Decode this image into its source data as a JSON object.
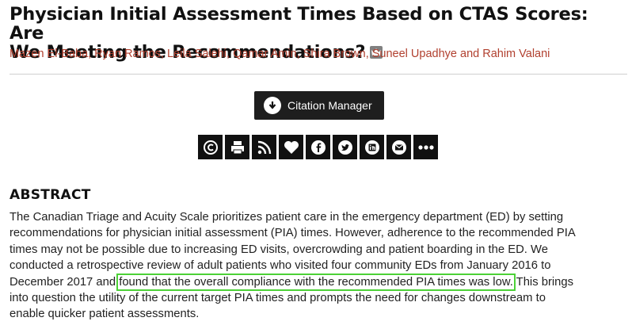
{
  "article": {
    "title_line1": "Physician Initial Assessment Times Based on CTAS Scores: Are",
    "title_line2": "We Meeting the Recommendations?",
    "authors": "Mazen El-Baba, Ryan Ramos, Leila Salehi, Qamar Amin, Shira Brown, Suneel Upadhye and Rahim Valani"
  },
  "actions": {
    "citation_manager": "Citation Manager",
    "tool_icons": [
      "copyright-icon",
      "print-icon",
      "rss-icon",
      "favorite-heart-icon",
      "facebook-icon",
      "twitter-icon",
      "linkedin-icon",
      "email-icon",
      "more-icon"
    ]
  },
  "abstract": {
    "heading": "ABSTRACT",
    "line1": "The Canadian Triage and Acuity Scale prioritizes patient care in the emergency department (ED) by setting",
    "line2": "recommendations for physician initial assessment (PIA) times. However, adherence to the recommended PIA",
    "line3": "times may not be possible due to increasing ED visits, overcrowding and patient boarding in the ED. We",
    "line4": "conducted a retrospective review of adult patients who visited four community EDs from January 2016 to",
    "line5_before": "December 2017 and ",
    "line5_highlight": "found that the overall compliance with the recommended PIA times was low.",
    "line5_after": " This brings",
    "line6": "into question the utility of the current target PIA times and prompts the need for changes downstream to",
    "line7": "enable quicker patient assessments."
  },
  "colors": {
    "author_link": "#b1402f",
    "highlight_box": "#4cd137",
    "toolbar_bg": "#111111"
  }
}
